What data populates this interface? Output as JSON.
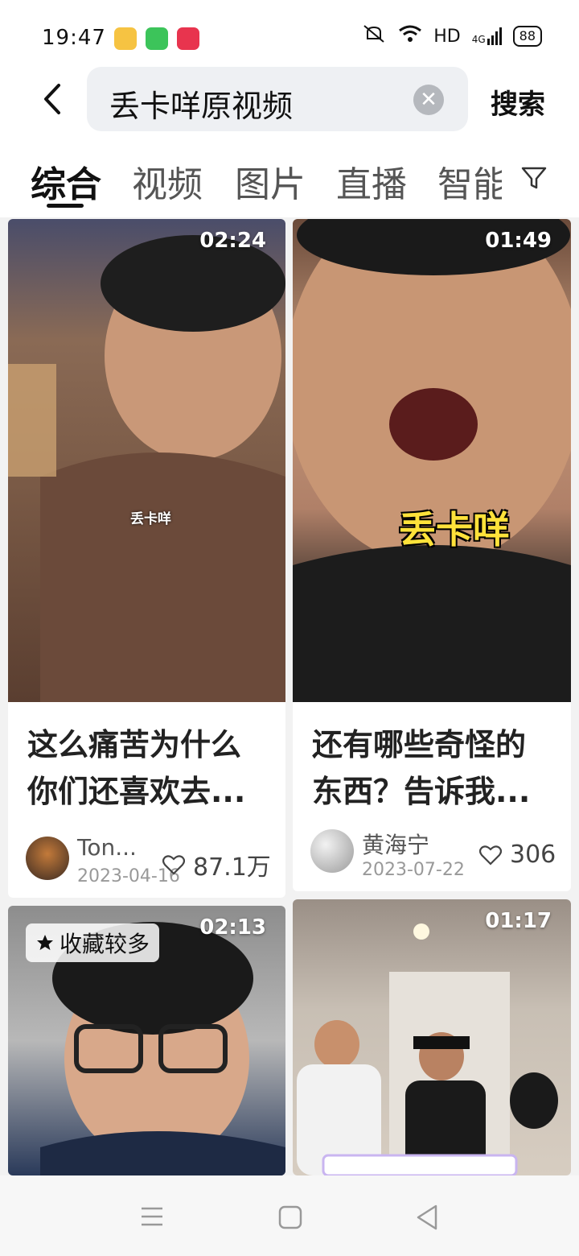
{
  "status_bar": {
    "time": "19:47",
    "network": "HD",
    "signal": "4G",
    "battery": "88"
  },
  "search": {
    "query": "丢卡咩原视频",
    "button_label": "搜索"
  },
  "tabs": [
    {
      "label": "综合",
      "active": true
    },
    {
      "label": "视频"
    },
    {
      "label": "图片"
    },
    {
      "label": "直播"
    },
    {
      "label": "智能"
    }
  ],
  "cards": [
    {
      "duration": "02:24",
      "title_line1": "这么痛苦为什么",
      "title_line2": "你们还喜欢去...",
      "author": "Ton...",
      "date": "2023-04-16",
      "likes": "87.1万",
      "overlay_text": "丢卡咩"
    },
    {
      "duration": "01:49",
      "title_line1": "还有哪些奇怪的",
      "title_line2": "东西？告诉我...",
      "author": "黄海宁",
      "date": "2023-07-22",
      "likes": "306",
      "overlay_text": "丢卡咩"
    },
    {
      "duration": "02:13",
      "badge": "收藏较多"
    },
    {
      "duration": "01:17"
    }
  ],
  "colors": {
    "accent": "#111111",
    "background": "#f2f2f2",
    "search_bg": "#eef0f3"
  }
}
